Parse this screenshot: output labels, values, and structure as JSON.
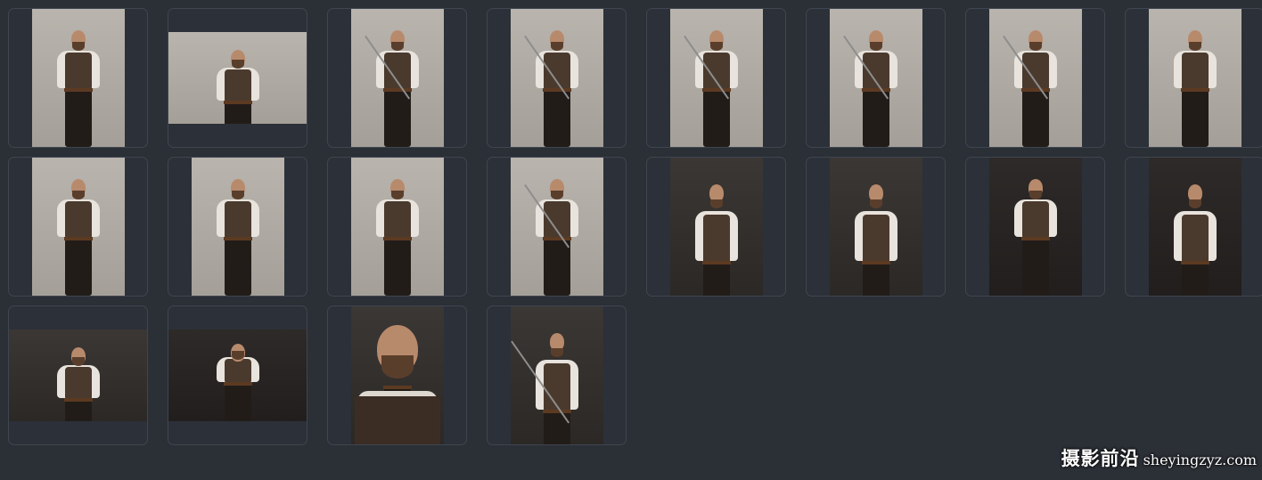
{
  "gallery": {
    "thumbnails": [
      {
        "orientation": "portrait",
        "tone": "light",
        "pose": "standing"
      },
      {
        "orientation": "landscape",
        "tone": "light",
        "pose": "half"
      },
      {
        "orientation": "portrait",
        "tone": "light",
        "pose": "standing-sword"
      },
      {
        "orientation": "portrait",
        "tone": "light",
        "pose": "standing-sword"
      },
      {
        "orientation": "portrait",
        "tone": "light",
        "pose": "standing-sword"
      },
      {
        "orientation": "portrait",
        "tone": "light",
        "pose": "standing-sword"
      },
      {
        "orientation": "portrait",
        "tone": "light",
        "pose": "standing-sword"
      },
      {
        "orientation": "portrait",
        "tone": "light",
        "pose": "standing"
      },
      {
        "orientation": "portrait",
        "tone": "light",
        "pose": "standing"
      },
      {
        "orientation": "portrait",
        "tone": "light",
        "pose": "standing"
      },
      {
        "orientation": "portrait",
        "tone": "light",
        "pose": "standing"
      },
      {
        "orientation": "portrait",
        "tone": "light",
        "pose": "standing-sword"
      },
      {
        "orientation": "portrait",
        "tone": "dark",
        "pose": "half"
      },
      {
        "orientation": "portrait",
        "tone": "dark",
        "pose": "half"
      },
      {
        "orientation": "portrait",
        "tone": "darkest",
        "pose": "standing"
      },
      {
        "orientation": "portrait",
        "tone": "darkest",
        "pose": "half"
      },
      {
        "orientation": "landscape",
        "tone": "dark",
        "pose": "half"
      },
      {
        "orientation": "landscape",
        "tone": "darkest",
        "pose": "standing"
      },
      {
        "orientation": "portrait",
        "tone": "dark",
        "pose": "closeup"
      },
      {
        "orientation": "portrait",
        "tone": "dark",
        "pose": "half-sword"
      }
    ]
  },
  "watermark": {
    "text_cn": "摄影前沿",
    "text_en": "sheyingzyz.com"
  },
  "colors": {
    "background": "#2b2f36",
    "card_border": "#3f4650"
  }
}
